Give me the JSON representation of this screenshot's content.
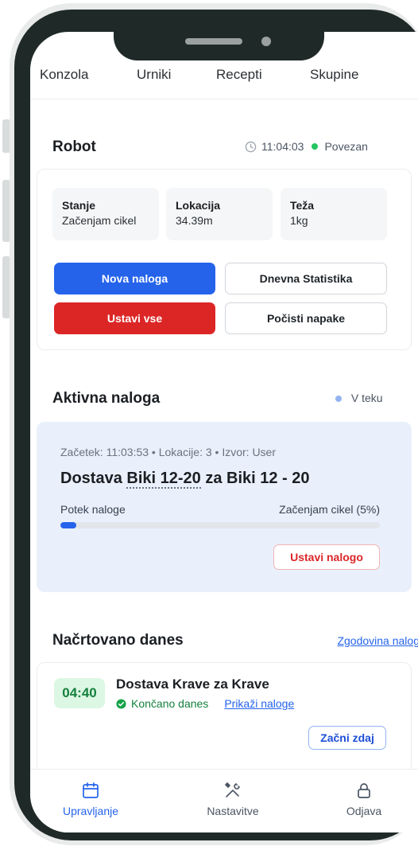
{
  "top_nav": {
    "items": [
      "Konzola",
      "Urniki",
      "Recepti",
      "Skupine"
    ]
  },
  "robot": {
    "title": "Robot",
    "time": "11:04:03",
    "status": "Povezan",
    "stats": [
      {
        "label": "Stanje",
        "value": "Začenjam cikel"
      },
      {
        "label": "Lokacija",
        "value": "34.39m"
      },
      {
        "label": "Teža",
        "value": "1kg"
      }
    ],
    "buttons": {
      "new_order": "Nova naloga",
      "daily_stats": "Dnevna Statistika",
      "stop_all": "Ustavi vse",
      "clear_errors": "Počisti napake"
    }
  },
  "active_order": {
    "title": "Aktivna naloga",
    "status": "V teku",
    "meta": "Začetek: 11:03:53 • Lokacije: 3 • Izvor: User",
    "name_prefix": "Dostava ",
    "name_link": "Biki 12-20",
    "name_suffix": " za Biki 12 - 20",
    "progress_label": "Potek naloge",
    "progress_status": "Začenjam cikel (5%)",
    "progress_fraction": 0.05,
    "stop_button": "Ustavi nalogo"
  },
  "planned": {
    "title": "Načrtovano danes",
    "history_link": "Zgodovina nalog",
    "items": [
      {
        "time": "04:40",
        "name": "Dostava Krave za Krave",
        "status": "Končano danes",
        "show_link": "Prikaži naloge",
        "start_button": "Začni zdaj"
      }
    ]
  },
  "bottom_nav": {
    "items": [
      "Upravljanje",
      "Nastavitve",
      "Odjava"
    ]
  },
  "colors": {
    "accent": "#2563eb",
    "danger": "#dc2626",
    "success": "#22c55e",
    "active_bg": "#e9f0fb",
    "frame": "#1f2a28"
  }
}
